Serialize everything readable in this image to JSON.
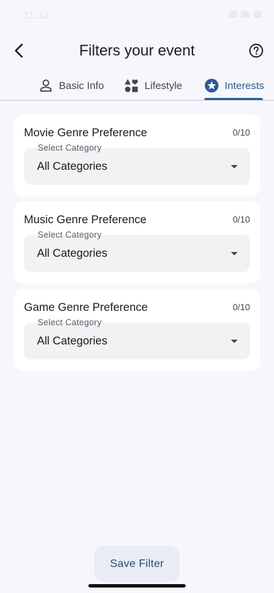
{
  "status": {
    "time": "11:12"
  },
  "header": {
    "title": "Filters your event",
    "back_icon": "arrow-back-icon",
    "help_icon": "help-circle-icon"
  },
  "tabs": [
    {
      "label": "Basic Info",
      "icon": "person-icon",
      "active": false
    },
    {
      "label": "Lifestyle",
      "icon": "category-shapes-icon",
      "active": false
    },
    {
      "label": "Interests",
      "icon": "star-circle-icon",
      "active": true
    }
  ],
  "cards": [
    {
      "title": "Movie Genre Preference",
      "count": "0/10",
      "select_label": "Select Category",
      "select_value": "All Categories"
    },
    {
      "title": "Music Genre Preference",
      "count": "0/10",
      "select_label": "Select Category",
      "select_value": "All Categories"
    },
    {
      "title": "Game Genre Preference",
      "count": "0/10",
      "select_label": "Select Category",
      "select_value": "All Categories"
    }
  ],
  "footer": {
    "save_label": "Save Filter"
  },
  "colors": {
    "accent": "#2b5b94",
    "background": "#f6f6fc",
    "card": "#ffffff",
    "field": "#f2f2f4",
    "button": "#e9ecf6"
  }
}
